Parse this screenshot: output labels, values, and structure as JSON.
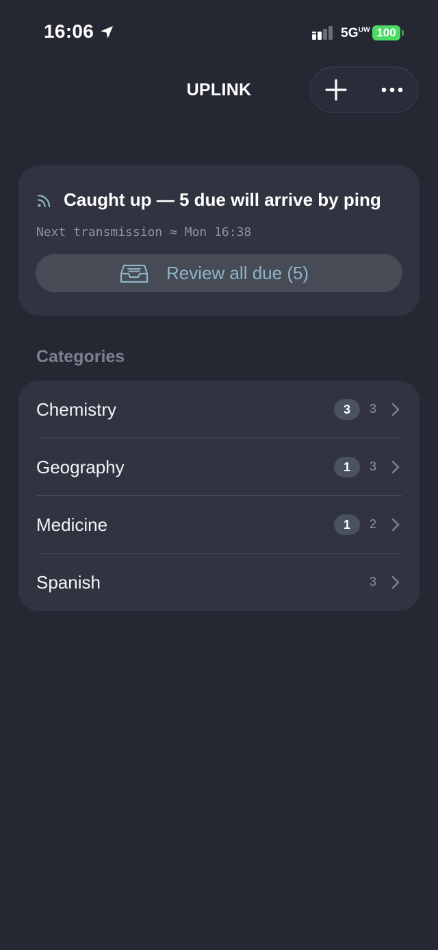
{
  "status_bar": {
    "time": "16:06",
    "network": "5G",
    "network_sup": "UW",
    "battery": "100"
  },
  "nav": {
    "title": "UPLINK"
  },
  "status_card": {
    "headline": "Caught up — 5 due will arrive by ping",
    "subline": "Next transmission ≈ Mon 16:38",
    "review_button_label": "Review all due (5)"
  },
  "categories": {
    "header": "Categories",
    "items": [
      {
        "label": "Chemistry",
        "due": "3",
        "total": "3"
      },
      {
        "label": "Geography",
        "due": "1",
        "total": "3"
      },
      {
        "label": "Medicine",
        "due": "1",
        "total": "2"
      },
      {
        "label": "Spanish",
        "due": "",
        "total": "3"
      }
    ]
  },
  "colors": {
    "background": "#252733",
    "card": "#313440",
    "accent": "#8fb4c8",
    "battery": "#4cd964"
  }
}
